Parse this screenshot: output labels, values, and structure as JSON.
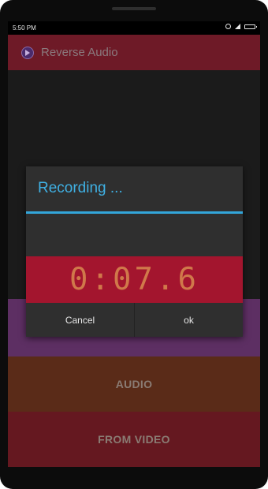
{
  "status": {
    "time": "5:50 PM"
  },
  "app": {
    "title": "Reverse Audio"
  },
  "main": {
    "buttons": [
      {
        "label": ""
      },
      {
        "label": "AUDIO"
      },
      {
        "label": "FROM VIDEO"
      }
    ]
  },
  "dialog": {
    "title": "Recording ...",
    "timer": "0:07.6",
    "cancel_label": "Cancel",
    "ok_label": "ok"
  },
  "colors": {
    "accent": "#3fb0e3",
    "appbar": "#6e1a27",
    "timer_bg": "#a3152e",
    "timer_text": "#d0784a"
  }
}
